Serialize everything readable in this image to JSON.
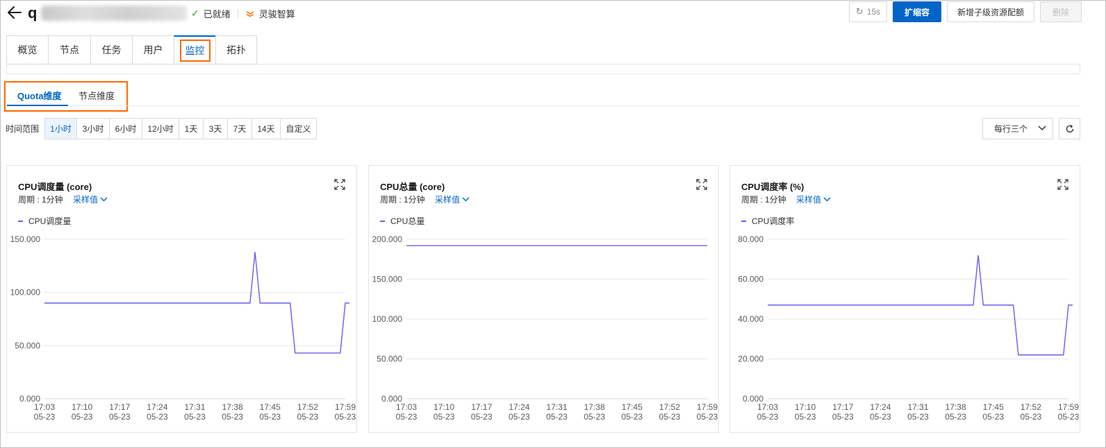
{
  "header": {
    "title_prefix": "q",
    "status": "已就绪",
    "brand": "灵骏智算",
    "refresh_label": "15s",
    "scale_label": "扩缩容",
    "add_quota_label": "新增子级资源配额",
    "delete_label": "删除"
  },
  "main_tabs": [
    "概览",
    "节点",
    "任务",
    "用户",
    "监控",
    "拓扑"
  ],
  "sub_tabs": [
    "Quota维度",
    "节点维度"
  ],
  "time_range": {
    "label": "时间范围",
    "options": [
      "1小时",
      "3小时",
      "6小时",
      "12小时",
      "1天",
      "3天",
      "7天",
      "14天",
      "自定义"
    ],
    "selected": "1小时"
  },
  "layout_select": {
    "value": "每行三个"
  },
  "icons": {
    "back": "back-arrow-icon",
    "status": "check-icon",
    "brand": "brand-logo-icon",
    "refresh": "refresh-icon",
    "expand": "fullscreen-icon",
    "chevron": "chevron-down-icon",
    "reload": "reload-icon"
  },
  "colors": {
    "primary": "#0064c8",
    "highlight": "#ff6a00",
    "series": "#6a5cf0",
    "success": "#23a042"
  },
  "cards": [
    {
      "title": "CPU调度量 (core)",
      "period": "周期 : 1分钟",
      "sample": "采样值",
      "legend": "CPU调度量"
    },
    {
      "title": "CPU总量 (core)",
      "period": "周期 : 1分钟",
      "sample": "采样值",
      "legend": "CPU总量"
    },
    {
      "title": "CPU调度率 (%)",
      "period": "周期 : 1分钟",
      "sample": "采样值",
      "legend": "CPU调度率"
    }
  ],
  "chart_data": [
    {
      "type": "line",
      "title": "CPU调度量 (core)",
      "x_ticks": [
        [
          "17:03",
          "05-23"
        ],
        [
          "17:10",
          "05-23"
        ],
        [
          "17:17",
          "05-23"
        ],
        [
          "17:24",
          "05-23"
        ],
        [
          "17:31",
          "05-23"
        ],
        [
          "17:38",
          "05-23"
        ],
        [
          "17:45",
          "05-23"
        ],
        [
          "17:52",
          "05-23"
        ],
        [
          "17:59",
          "05-23"
        ]
      ],
      "y_ticks": [
        "150.000",
        "100.000",
        "50.000",
        "0.000"
      ],
      "ylim": [
        0,
        150
      ],
      "series": [
        {
          "name": "CPU调度量",
          "points": [
            [
              0,
              90
            ],
            [
              41,
              90
            ],
            [
              42,
              138
            ],
            [
              43,
              90
            ],
            [
              49,
              90
            ],
            [
              50,
              43
            ],
            [
              59,
              43
            ],
            [
              60,
              90
            ],
            [
              61,
              90
            ]
          ]
        }
      ]
    },
    {
      "type": "line",
      "title": "CPU总量 (core)",
      "x_ticks": [
        [
          "17:03",
          "05-23"
        ],
        [
          "17:10",
          "05-23"
        ],
        [
          "17:17",
          "05-23"
        ],
        [
          "17:24",
          "05-23"
        ],
        [
          "17:31",
          "05-23"
        ],
        [
          "17:38",
          "05-23"
        ],
        [
          "17:45",
          "05-23"
        ],
        [
          "17:52",
          "05-23"
        ],
        [
          "17:59",
          "05-23"
        ]
      ],
      "y_ticks": [
        "200.000",
        "150.000",
        "100.000",
        "50.000",
        "0.000"
      ],
      "ylim": [
        0,
        200
      ],
      "series": [
        {
          "name": "CPU总量",
          "points": [
            [
              0,
              192
            ],
            [
              60,
              192
            ]
          ]
        }
      ]
    },
    {
      "type": "line",
      "title": "CPU调度率 (%)",
      "x_ticks": [
        [
          "17:03",
          "05-23"
        ],
        [
          "17:10",
          "05-23"
        ],
        [
          "17:17",
          "05-23"
        ],
        [
          "17:24",
          "05-23"
        ],
        [
          "17:31",
          "05-23"
        ],
        [
          "17:38",
          "05-23"
        ],
        [
          "17:45",
          "05-23"
        ],
        [
          "17:52",
          "05-23"
        ],
        [
          "17:59",
          "05-23"
        ]
      ],
      "y_ticks": [
        "80.000",
        "60.000",
        "40.000",
        "20.000",
        "0.000"
      ],
      "ylim": [
        0,
        80
      ],
      "series": [
        {
          "name": "CPU调度率",
          "points": [
            [
              0,
              47
            ],
            [
              41,
              47
            ],
            [
              42,
              72
            ],
            [
              43,
              47
            ],
            [
              49,
              47
            ],
            [
              50,
              22
            ],
            [
              59,
              22
            ],
            [
              60,
              47
            ],
            [
              61,
              47
            ]
          ]
        }
      ]
    }
  ]
}
